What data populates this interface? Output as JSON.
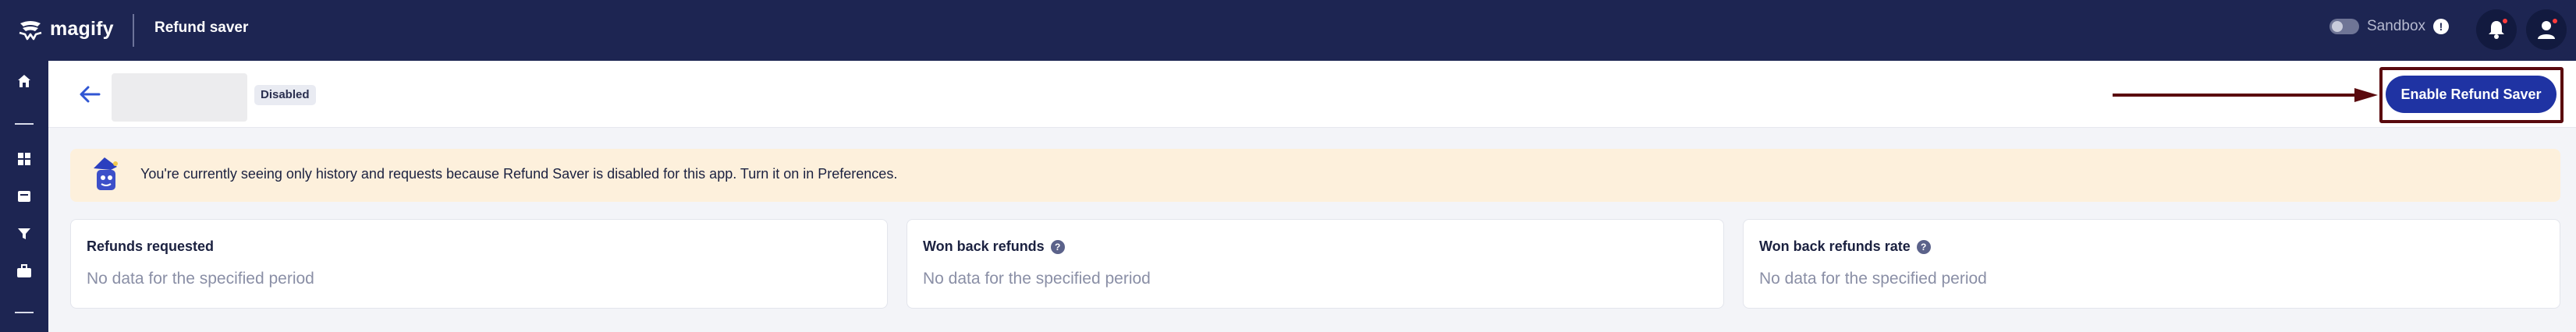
{
  "topbar": {
    "brand": "magify",
    "app_title": "Refund saver",
    "sandbox_label": "Sandbox",
    "sandbox_enabled": false,
    "info_icon": "info-icon",
    "bell_icon": "bell-icon",
    "user_icon": "user-icon"
  },
  "sidebar": {
    "icons": [
      "home-icon",
      "dashboard-icon",
      "inventory-icon",
      "filter-icon",
      "briefcase-icon"
    ]
  },
  "header": {
    "back_icon": "back-arrow-icon",
    "status_badge": "Disabled",
    "enable_button": "Enable Refund Saver"
  },
  "banner": {
    "text": "You're currently seeing only history and requests because Refund Saver is disabled for this app. Turn it on in Preferences."
  },
  "cards": [
    {
      "title": "Refunds requested",
      "empty": "No data for the specified period",
      "help": false
    },
    {
      "title": "Won back refunds",
      "empty": "No data for the specified period",
      "help": true
    },
    {
      "title": "Won back refunds rate",
      "empty": "No data for the specified period",
      "help": true
    }
  ],
  "colors": {
    "topbar": "#1d2552",
    "accent": "#1f33a3",
    "banner": "#fdf0dc",
    "highlight": "#5a0a0e"
  }
}
